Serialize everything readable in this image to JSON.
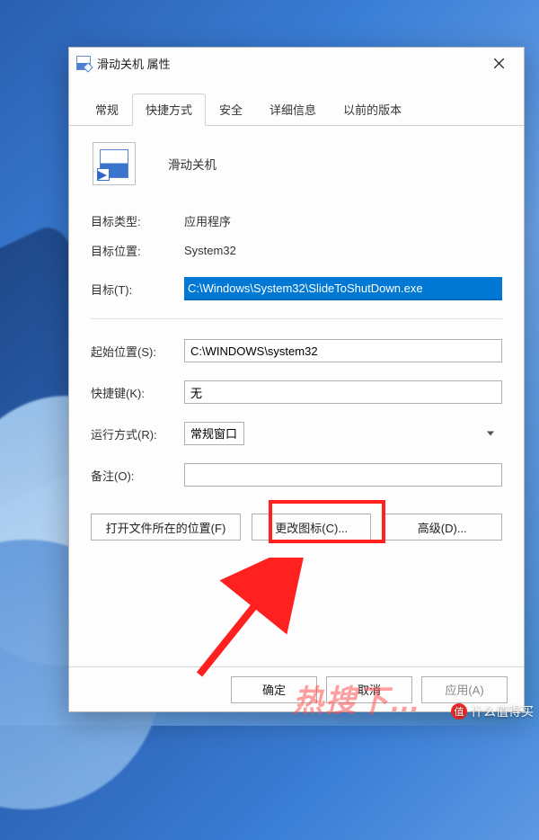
{
  "dialog": {
    "title": "滑动关机 属性",
    "close_tooltip": "关闭"
  },
  "tabs": [
    {
      "label": "常规",
      "active": false
    },
    {
      "label": "快捷方式",
      "active": true
    },
    {
      "label": "安全",
      "active": false
    },
    {
      "label": "详细信息",
      "active": false
    },
    {
      "label": "以前的版本",
      "active": false
    }
  ],
  "app_name": "滑动关机",
  "fields": {
    "target_type_label": "目标类型:",
    "target_type_value": "应用程序",
    "target_location_label": "目标位置:",
    "target_location_value": "System32",
    "target_label": "目标(T):",
    "target_value": "C:\\Windows\\System32\\SlideToShutDown.exe",
    "start_in_label": "起始位置(S):",
    "start_in_value": "C:\\WINDOWS\\system32",
    "shortcut_key_label": "快捷键(K):",
    "shortcut_key_value": "无",
    "run_label": "运行方式(R):",
    "run_value": "常规窗口",
    "comment_label": "备注(O):",
    "comment_value": ""
  },
  "mid_buttons": {
    "open_location": "打开文件所在的位置(F)",
    "change_icon": "更改图标(C)...",
    "advanced": "高级(D)..."
  },
  "bottom_buttons": {
    "ok": "确定",
    "cancel": "取消",
    "apply": "应用(A)"
  },
  "watermarks": {
    "red": "热搜下…",
    "zhi_badge": "值",
    "zhi_text": "什么值得买"
  }
}
